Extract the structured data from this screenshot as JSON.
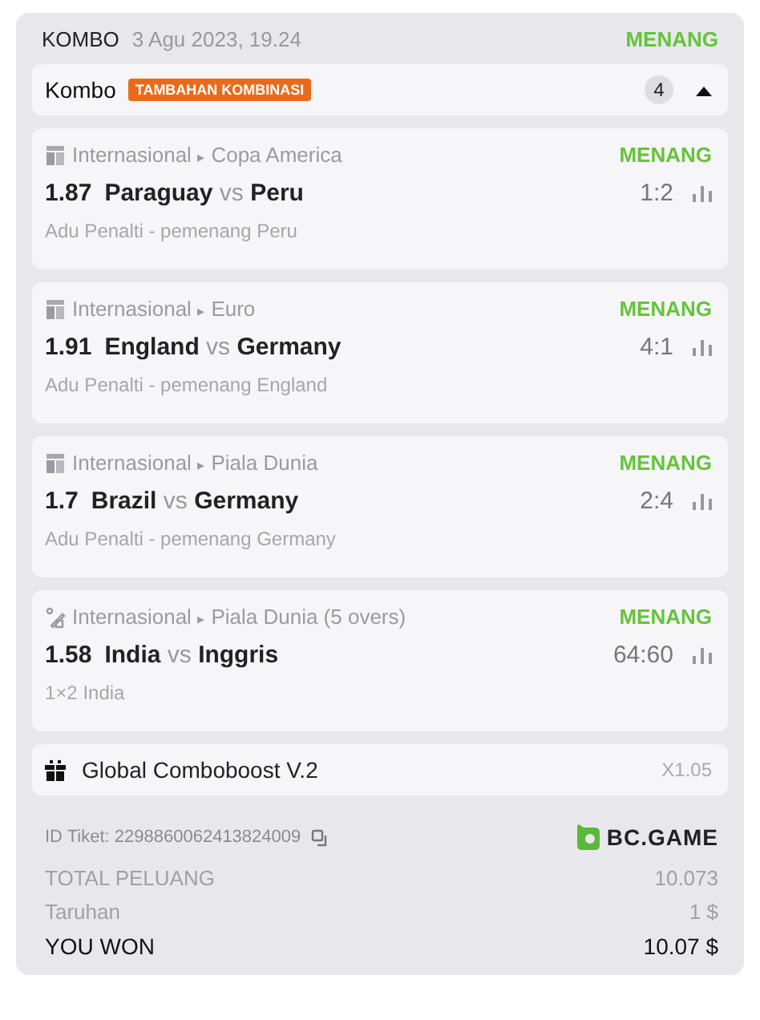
{
  "header": {
    "type": "KOMBO",
    "date": "3 Agu 2023, 19.24",
    "status": "MENANG"
  },
  "combo_bar": {
    "title": "Kombo",
    "badge": "TAMBAHAN KOMBINASI",
    "count": "4",
    "expanded": true
  },
  "bets": [
    {
      "kind": "fifa",
      "category": "Internasional",
      "separator": "▸",
      "league": "Copa America",
      "status": "MENANG",
      "odds": "1.87",
      "home": "Paraguay",
      "vs": "vs",
      "away": "Peru",
      "score": "1:2",
      "market": "Adu Penalti - pemenang Peru"
    },
    {
      "kind": "fifa",
      "category": "Internasional",
      "separator": "▸",
      "league": "Euro",
      "status": "MENANG",
      "odds": "1.91",
      "home": "England",
      "vs": "vs",
      "away": "Germany",
      "score": "4:1",
      "market": "Adu Penalti - pemenang England"
    },
    {
      "kind": "fifa",
      "category": "Internasional",
      "separator": "▸",
      "league": "Piala Dunia",
      "status": "MENANG",
      "odds": "1.7",
      "home": "Brazil",
      "vs": "vs",
      "away": "Germany",
      "score": "2:4",
      "market": "Adu Penalti - pemenang Germany"
    },
    {
      "kind": "cricket",
      "category": "Internasional",
      "separator": "▸",
      "league": "Piala Dunia (5 overs)",
      "status": "MENANG",
      "odds": "1.58",
      "home": "India",
      "vs": "vs",
      "away": "Inggris",
      "score": "64:60",
      "market": "1×2 India"
    }
  ],
  "boost": {
    "label": "Global Comboboost V.2",
    "multiplier": "X1.05"
  },
  "ticket": {
    "id_label": "ID Tiket: 2298860062413824009",
    "brand": "BC.GAME"
  },
  "summary": [
    {
      "kind": "muted",
      "label": "TOTAL PELUANG",
      "value": "10.073"
    },
    {
      "kind": "muted",
      "label": "Taruhan",
      "value": "1 $"
    },
    {
      "kind": "strong",
      "label": "YOU WON",
      "value": "10.07 $"
    }
  ]
}
